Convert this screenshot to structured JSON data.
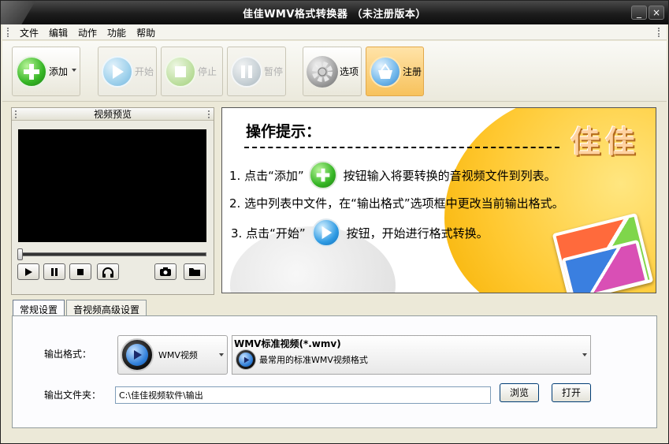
{
  "window": {
    "title": "佳佳WMV格式转换器 （未注册版本）",
    "min_label": "_",
    "close_label": "×"
  },
  "menu": {
    "items": [
      "文件",
      "编辑",
      "动作",
      "功能",
      "帮助"
    ]
  },
  "toolbar": {
    "add": "添加",
    "start": "开始",
    "stop": "停止",
    "pause": "暂停",
    "options": "选项",
    "register": "注册"
  },
  "preview": {
    "title": "视频预览"
  },
  "tips": {
    "title": "操作提示：",
    "brand": "佳佳",
    "line1_a": "1. 点击“添加”",
    "line1_b": "按钮输入将要转换的音视频文件到列表。",
    "line2": "2. 选中列表中文件，在“输出格式”选项框中更改当前输出格式。",
    "line3_a": "3. 点击“开始”",
    "line3_b": "按钮，开始进行格式转换。"
  },
  "tabs": [
    "常规设置",
    "音视频高级设置"
  ],
  "settings": {
    "format_label": "输出格式：",
    "format_value": "WMV视频",
    "format_title": "WMV标准视频(*.wmv)",
    "format_desc": "最常用的标准WMV视频格式",
    "folder_label": "输出文件夹：",
    "folder_value": "C:\\佳佳视频软件\\输出",
    "browse": "浏览",
    "open": "打开"
  }
}
